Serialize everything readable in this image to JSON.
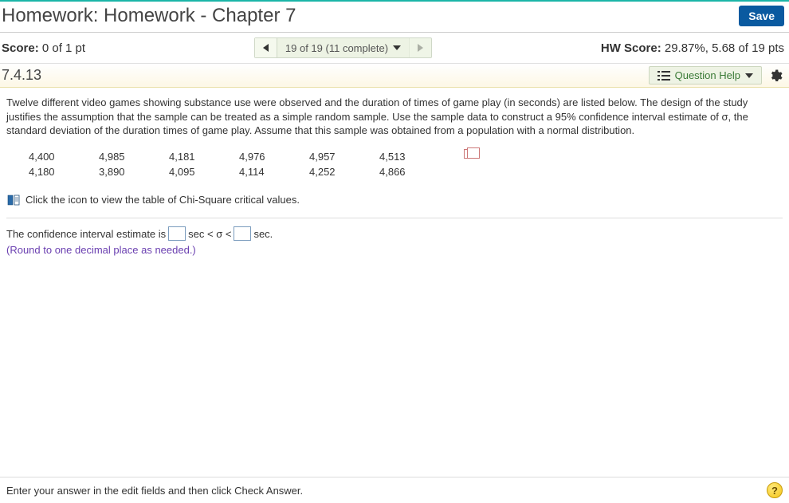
{
  "header": {
    "title": "Homework: Homework - Chapter 7",
    "save_label": "Save"
  },
  "subheader": {
    "score_label": "Score:",
    "score_value": "0 of 1 pt",
    "nav_label": "19 of 19 (11 complete)",
    "hw_score_label": "HW Score:",
    "hw_score_value": "29.87%, 5.68 of 19 pts"
  },
  "question_bar": {
    "number": "7.4.13",
    "help_label": "Question Help"
  },
  "problem": {
    "text": "Twelve different video games showing substance use were observed and the duration of times of game play (in seconds) are listed below. The design of the study justifies the assumption that the sample can be treated as a simple random sample. Use the sample data to construct a 95% confidence interval estimate of σ, the standard deviation of the duration times of game play. Assume that this sample was obtained from a population with a normal distribution.",
    "data_rows": [
      [
        "4,400",
        "4,985",
        "4,181",
        "4,976",
        "4,957",
        "4,513"
      ],
      [
        "4,180",
        "3,890",
        "4,095",
        "4,114",
        "4,252",
        "4,866"
      ]
    ],
    "table_link_text": "Click the icon to view the table of Chi-Square critical values."
  },
  "answer": {
    "prefix": "The confidence interval estimate is",
    "unit1": "sec < σ <",
    "unit2": "sec.",
    "round_note": "(Round to one decimal place as needed.)"
  },
  "footer": {
    "instruction": "Enter your answer in the edit fields and then click Check Answer."
  }
}
